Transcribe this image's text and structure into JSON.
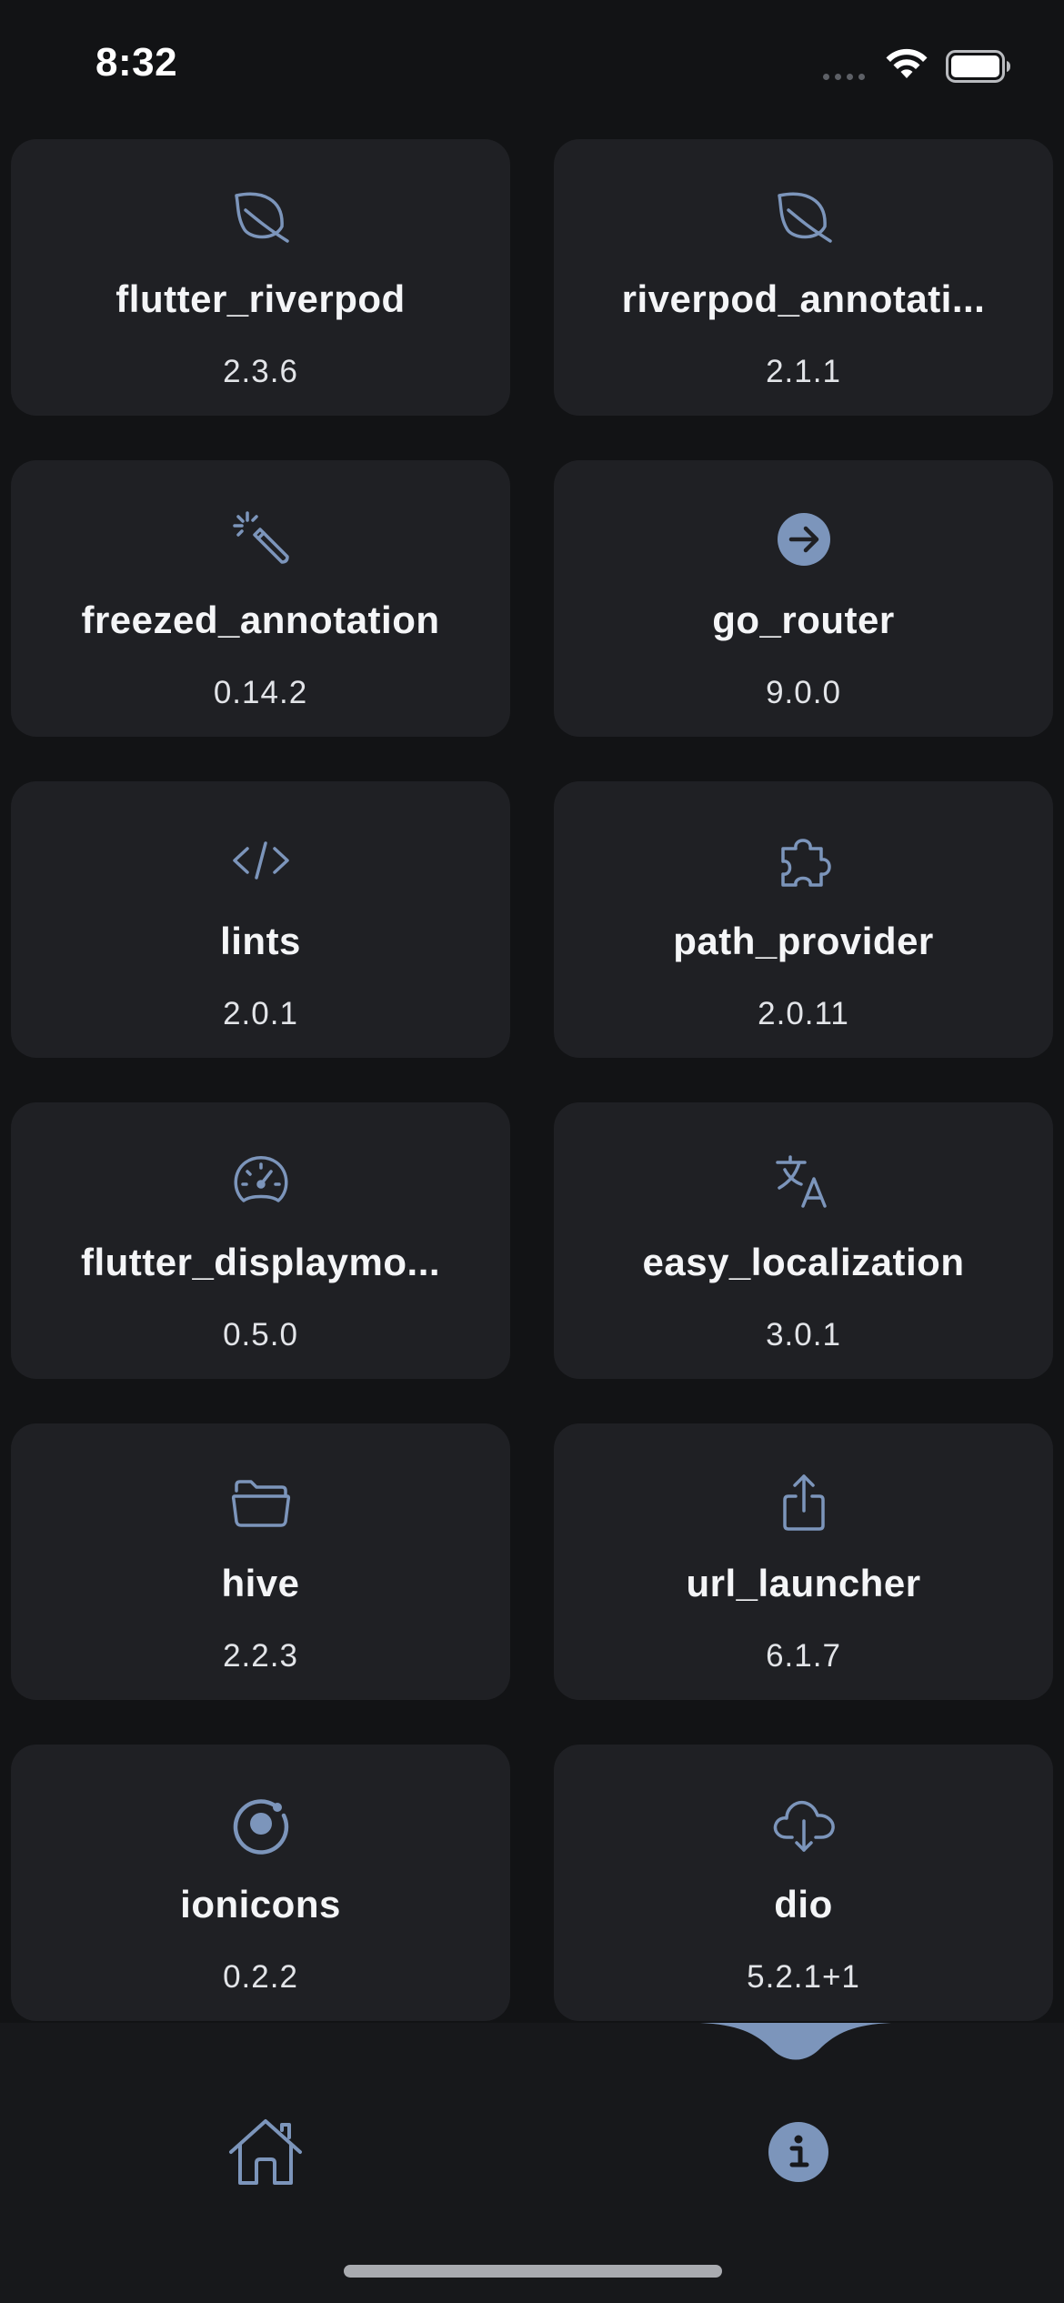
{
  "status_bar": {
    "time": "8:32"
  },
  "colors": {
    "background": "#121315",
    "card": "#1f2024",
    "accent": "#7c95bb",
    "title": "#f4f5f7",
    "nav_background": "#17181b"
  },
  "packages": [
    {
      "name": "flutter_riverpod",
      "version": "2.3.6",
      "icon": "leaf-icon"
    },
    {
      "name": "riverpod_annotati...",
      "version": "2.1.1",
      "icon": "leaf-icon"
    },
    {
      "name": "freezed_annotation",
      "version": "0.14.2",
      "icon": "magic-wand-icon"
    },
    {
      "name": "go_router",
      "version": "9.0.0",
      "icon": "arrow-circle-right-icon"
    },
    {
      "name": "lints",
      "version": "2.0.1",
      "icon": "code-icon"
    },
    {
      "name": "path_provider",
      "version": "2.0.11",
      "icon": "puzzle-icon"
    },
    {
      "name": "flutter_displaymo...",
      "version": "0.5.0",
      "icon": "speedometer-icon"
    },
    {
      "name": "easy_localization",
      "version": "3.0.1",
      "icon": "translate-icon"
    },
    {
      "name": "hive",
      "version": "2.2.3",
      "icon": "folder-open-icon"
    },
    {
      "name": "url_launcher",
      "version": "6.1.7",
      "icon": "share-icon"
    },
    {
      "name": "ionicons",
      "version": "0.2.2",
      "icon": "ionic-icon"
    },
    {
      "name": "dio",
      "version": "5.2.1+1",
      "icon": "cloud-download-icon"
    }
  ],
  "bottom_nav": {
    "items": [
      {
        "icon": "home-icon",
        "active": false
      },
      {
        "icon": "info-icon",
        "active": true
      }
    ]
  }
}
